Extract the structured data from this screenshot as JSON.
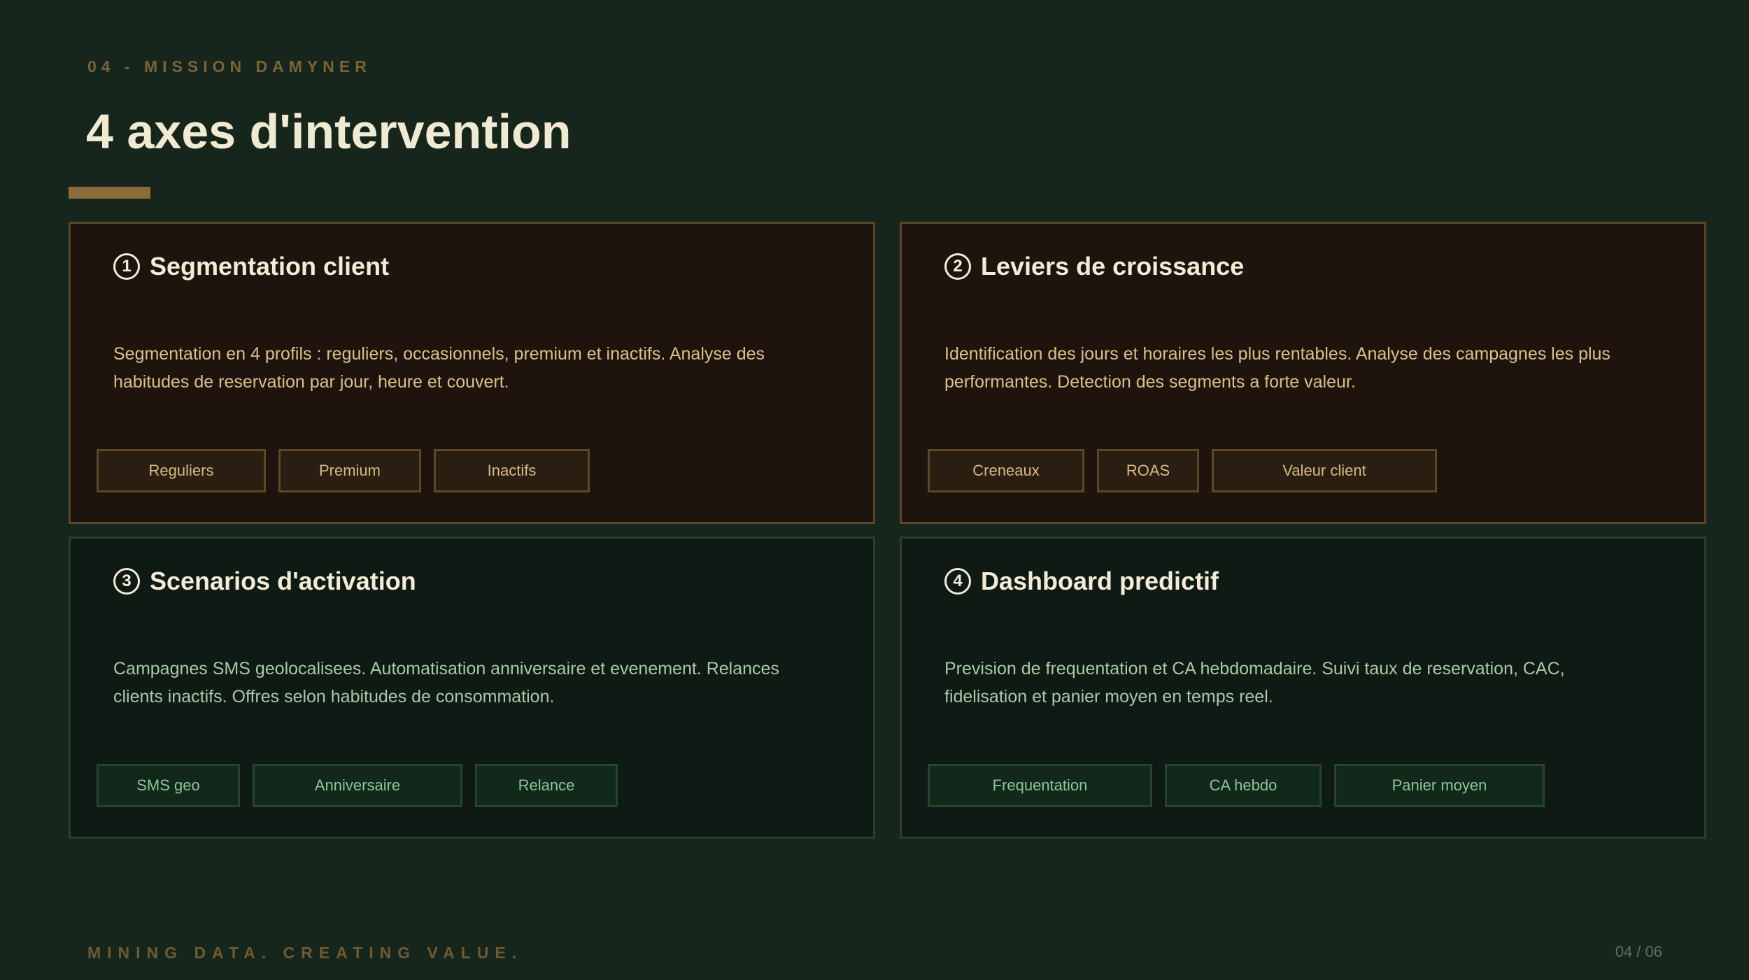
{
  "header": {
    "eyebrow": "04 - MISSION DAMYNER",
    "title": "4 axes d'intervention"
  },
  "cards": [
    {
      "number": "1",
      "title": "Segmentation client",
      "description": "Segmentation en 4 profils : reguliers, occasionnels, premium et inactifs. Analyse des habitudes de reservation par jour, heure et couvert.",
      "tags": [
        "Reguliers",
        "Premium",
        "Inactifs"
      ]
    },
    {
      "number": "2",
      "title": "Leviers de croissance",
      "description": "Identification des jours et horaires les plus rentables. Analyse des campagnes les plus performantes. Detection des segments a forte valeur.",
      "tags": [
        "Creneaux",
        "ROAS",
        "Valeur client"
      ]
    },
    {
      "number": "3",
      "title": "Scenarios d'activation",
      "description": "Campagnes SMS geolocalisees. Automatisation anniversaire et evenement. Relances clients inactifs. Offres selon habitudes de consommation.",
      "tags": [
        "SMS geo",
        "Anniversaire",
        "Relance"
      ]
    },
    {
      "number": "4",
      "title": "Dashboard predictif",
      "description": "Prevision de frequentation et CA hebdomadaire. Suivi taux de reservation, CAC, fidelisation et panier moyen en temps reel.",
      "tags": [
        "Frequentation",
        "CA hebdo",
        "Panier moyen"
      ]
    }
  ],
  "footer": {
    "tagline": "MINING DATA. CREATING VALUE.",
    "page": "04 / 06"
  },
  "colors": {
    "background": "#17261d",
    "accent": "#8a6b3a",
    "title": "#f1ead2"
  }
}
